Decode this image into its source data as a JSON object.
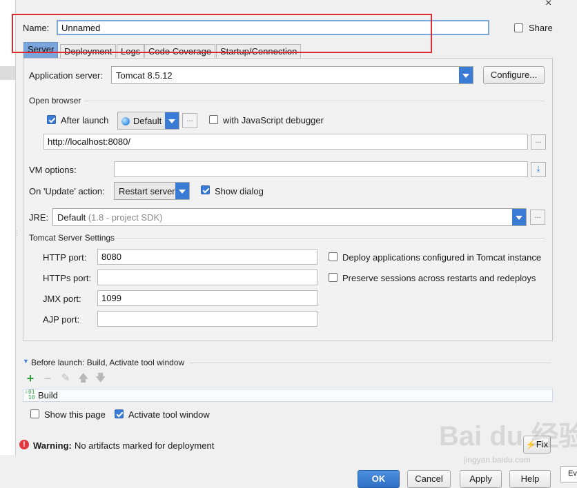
{
  "header": {
    "name_label": "Name:",
    "name_value": "Unnamed",
    "share_label": "Share",
    "share_checked": false
  },
  "tabs": [
    {
      "label": "Server",
      "active": true
    },
    {
      "label": "Deployment",
      "active": false
    },
    {
      "label": "Logs",
      "active": false
    },
    {
      "label": "Code Coverage",
      "active": false
    },
    {
      "label": "Startup/Connection",
      "active": false
    }
  ],
  "server": {
    "app_server_label": "Application server:",
    "app_server_value": "Tomcat 8.5.12",
    "configure_label": "Configure..."
  },
  "open_browser": {
    "title": "Open browser",
    "after_launch_label": "After launch",
    "after_launch_checked": true,
    "browser_value": "Default",
    "more_label": "...",
    "js_debugger_label": "with JavaScript debugger",
    "js_debugger_checked": false,
    "url": "http://localhost:8080/"
  },
  "vm": {
    "label": "VM options:",
    "value": ""
  },
  "update_action": {
    "label": "On 'Update' action:",
    "value": "Restart server",
    "show_dialog_label": "Show dialog",
    "show_dialog_checked": true
  },
  "jre": {
    "label": "JRE:",
    "value": "Default",
    "hint": "(1.8 - project SDK)"
  },
  "tomcat_settings": {
    "title": "Tomcat Server Settings",
    "http_port_label": "HTTP port:",
    "http_port_value": "8080",
    "https_port_label": "HTTPs port:",
    "https_port_value": "",
    "jmx_port_label": "JMX port:",
    "jmx_port_value": "1099",
    "ajp_port_label": "AJP port:",
    "ajp_port_value": "",
    "deploy_configured_label": "Deploy applications configured in Tomcat instance",
    "deploy_configured_checked": false,
    "preserve_sessions_label": "Preserve sessions across restarts and redeploys",
    "preserve_sessions_checked": false
  },
  "before_launch": {
    "title": "Before launch: Build, Activate tool window",
    "tasks": [
      "Build"
    ],
    "show_page_label": "Show this page",
    "show_page_checked": false,
    "activate_tool_label": "Activate tool window",
    "activate_tool_checked": true
  },
  "warning": {
    "label": "Warning:",
    "message": "No artifacts marked for deployment",
    "fix_label": "Fix"
  },
  "footer": {
    "ok_label": "OK",
    "cancel_label": "Cancel",
    "apply_label": "Apply",
    "help_label": "Help"
  },
  "watermark": {
    "logo_text": "Bai du 经验",
    "url_text": "jingyan.baidu.com"
  },
  "background_window": {
    "partial_label": "Eve"
  },
  "colors": {
    "accent": "#3a7bd5",
    "active_tab": "#7aa6dd",
    "highlight_box": "#e0282f",
    "warning": "#e0383e",
    "add_green": "#2e9e3a"
  }
}
